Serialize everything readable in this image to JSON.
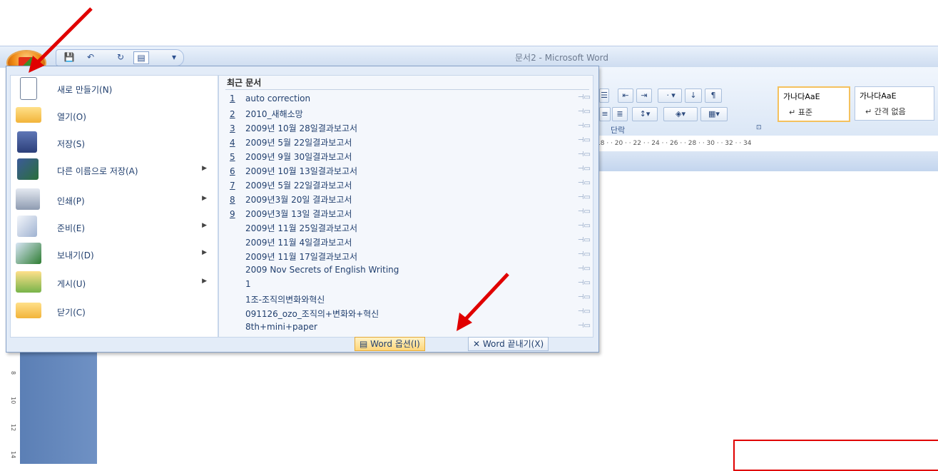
{
  "window": {
    "title": "문서2 - Microsoft Word"
  },
  "qat": {
    "items": [
      {
        "name": "save-icon",
        "glyph": "💾"
      },
      {
        "name": "undo-icon",
        "glyph": "↶"
      },
      {
        "name": "redo-icon",
        "glyph": "↻"
      },
      {
        "name": "print-preview-icon",
        "glyph": "▤"
      },
      {
        "name": "customize-icon",
        "glyph": "▾"
      }
    ]
  },
  "office_menu": {
    "items": [
      {
        "label": "새로 만들기(N)",
        "arrow": ""
      },
      {
        "label": "열기(O)",
        "arrow": ""
      },
      {
        "label": "저장(S)",
        "arrow": ""
      },
      {
        "label": "다른 이름으로 저장(A)",
        "arrow": "▶"
      },
      {
        "label": "인쇄(P)",
        "arrow": "▶"
      },
      {
        "label": "준비(E)",
        "arrow": "▶"
      },
      {
        "label": "보내기(D)",
        "arrow": "▶"
      },
      {
        "label": "게시(U)",
        "arrow": "▶"
      },
      {
        "label": "닫기(C)",
        "arrow": ""
      }
    ],
    "recent_title": "최근 문서",
    "recent": [
      {
        "num": "1",
        "name": "auto correction"
      },
      {
        "num": "2",
        "name": "2010_새해소망"
      },
      {
        "num": "3",
        "name": "2009년 10월 28일결과보고서"
      },
      {
        "num": "4",
        "name": "2009년 5월 22일결과보고서"
      },
      {
        "num": "5",
        "name": "2009년 9월 30일결과보고서"
      },
      {
        "num": "6",
        "name": "2009년 10월 13일결과보고서"
      },
      {
        "num": "7",
        "name": "2009년 5월 22일결과보고서"
      },
      {
        "num": "8",
        "name": "2009년3월 20일 결과보고서"
      },
      {
        "num": "9",
        "name": "2009년3월 13일 결과보고서"
      },
      {
        "num": "",
        "name": "2009년 11월 25일결과보고서"
      },
      {
        "num": "",
        "name": "2009년 11월 4일결과보고서"
      },
      {
        "num": "",
        "name": "2009년 11월 17일결과보고서"
      },
      {
        "num": "",
        "name": "2009 Nov  Secrets of English Writing"
      },
      {
        "num": "",
        "name": "1"
      },
      {
        "num": "",
        "name": "1조-조직의변화와혁신"
      },
      {
        "num": "",
        "name": "091126_ozo_조직의+변화와+혁신"
      },
      {
        "num": "",
        "name": "8th+mini+paper"
      }
    ],
    "pin_glyph": "⊣▭",
    "options_label": "Word 옵션(I)",
    "exit_label": "Word 끝내기(X)"
  },
  "ribbon": {
    "paragraph_label": "단락",
    "launcher_glyph": "⊡",
    "styles": [
      {
        "preview": "가나다AaE",
        "name": "↵ 표준"
      },
      {
        "preview": "가나다AaE",
        "name": "↵ 간격 없음"
      }
    ],
    "ruler_text": "18 ·  · 20 ·  · 22 ·  · 24 ·  · 26 ·  · 28 ·  · 30 ·  · 32 ·  · 34",
    "vruler_text": [
      "8",
      "10",
      "12",
      "14"
    ]
  },
  "colors": {
    "annotation": "#e00000",
    "highlight": "#ffd67a",
    "orb": "#f08a13"
  }
}
